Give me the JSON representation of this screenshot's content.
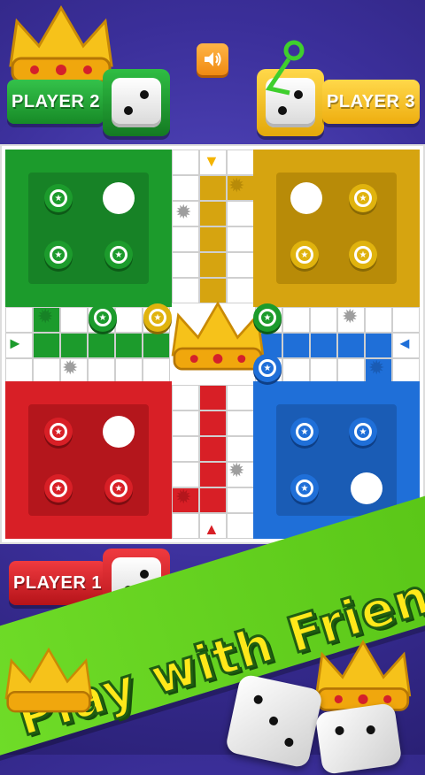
{
  "players": {
    "p1": {
      "label": "PLAYER 1",
      "color": "#d81f26",
      "dice": 2
    },
    "p2": {
      "label": "PLAYER 2",
      "color": "#1a9a2f",
      "dice": 2
    },
    "p3": {
      "label": "PLAYER 3",
      "color": "#f4b400",
      "dice": 2
    },
    "p4": {
      "color": "#1aa8e8"
    }
  },
  "banner": {
    "text": "Play with Friend"
  },
  "colors": {
    "green": "#1c9b2c",
    "yellow": "#d6a410",
    "red": "#d81f26",
    "blue": "#1f6fd8",
    "banner": "#62d11c"
  },
  "icons": [
    "sound-icon",
    "crown-icon",
    "dice-icon",
    "star-icon",
    "arrow-icon"
  ]
}
